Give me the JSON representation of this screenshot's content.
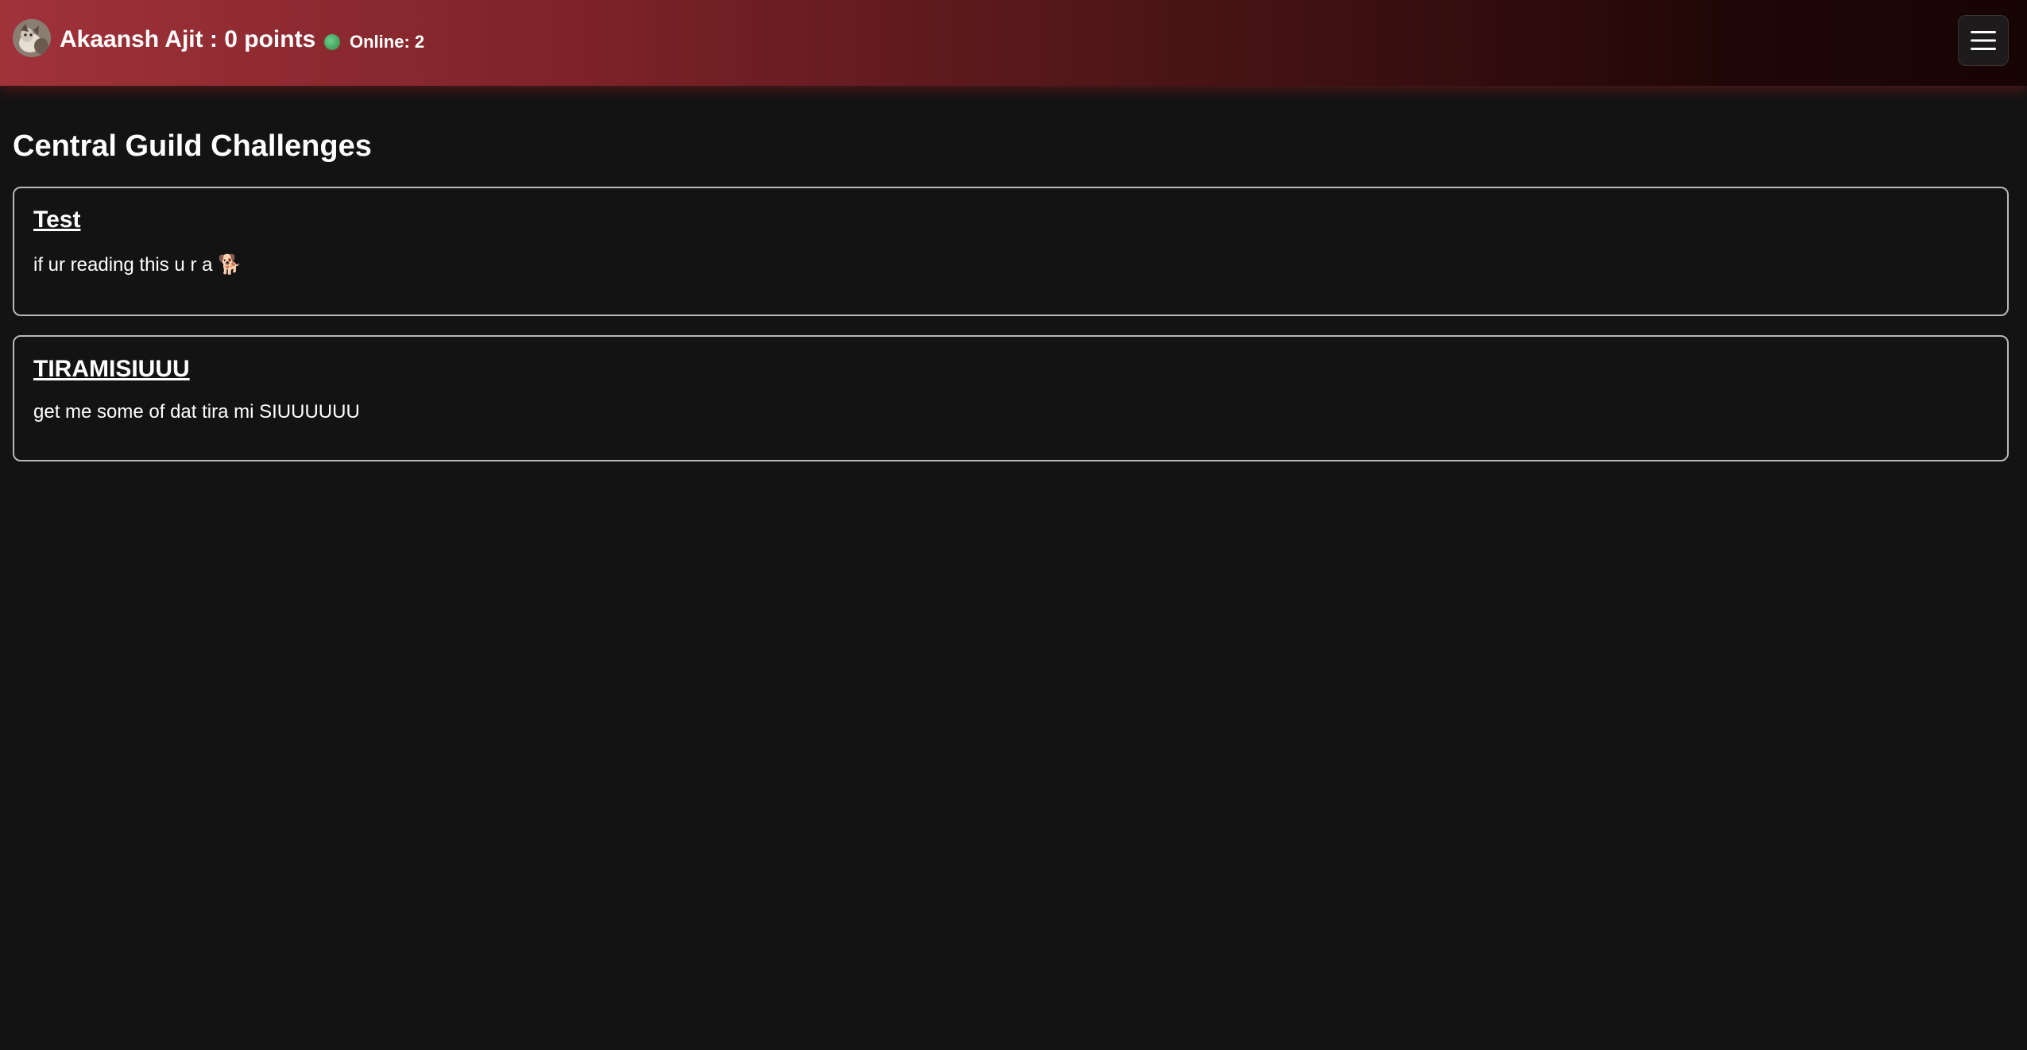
{
  "header": {
    "user_status": "Akaansh Ajit : 0 points",
    "online_label": "Online: 2",
    "online_color": "#3f9e5a",
    "avatar_icon": "avatar-photo",
    "menu_icon": "hamburger-menu-icon",
    "brand_gradient_start": "#a0323a",
    "brand_gradient_end": "#170404"
  },
  "main": {
    "title": "Central Guild Challenges",
    "challenges": [
      {
        "title": "Test",
        "description": "if ur reading this u r a 🐕"
      },
      {
        "title": "TIRAMISIUUU",
        "description": "get me some of dat tira mi SIUUUUUU"
      }
    ]
  },
  "colors": {
    "background": "#131313",
    "card_border": "#b9b9b9",
    "text": "#ffffff"
  }
}
